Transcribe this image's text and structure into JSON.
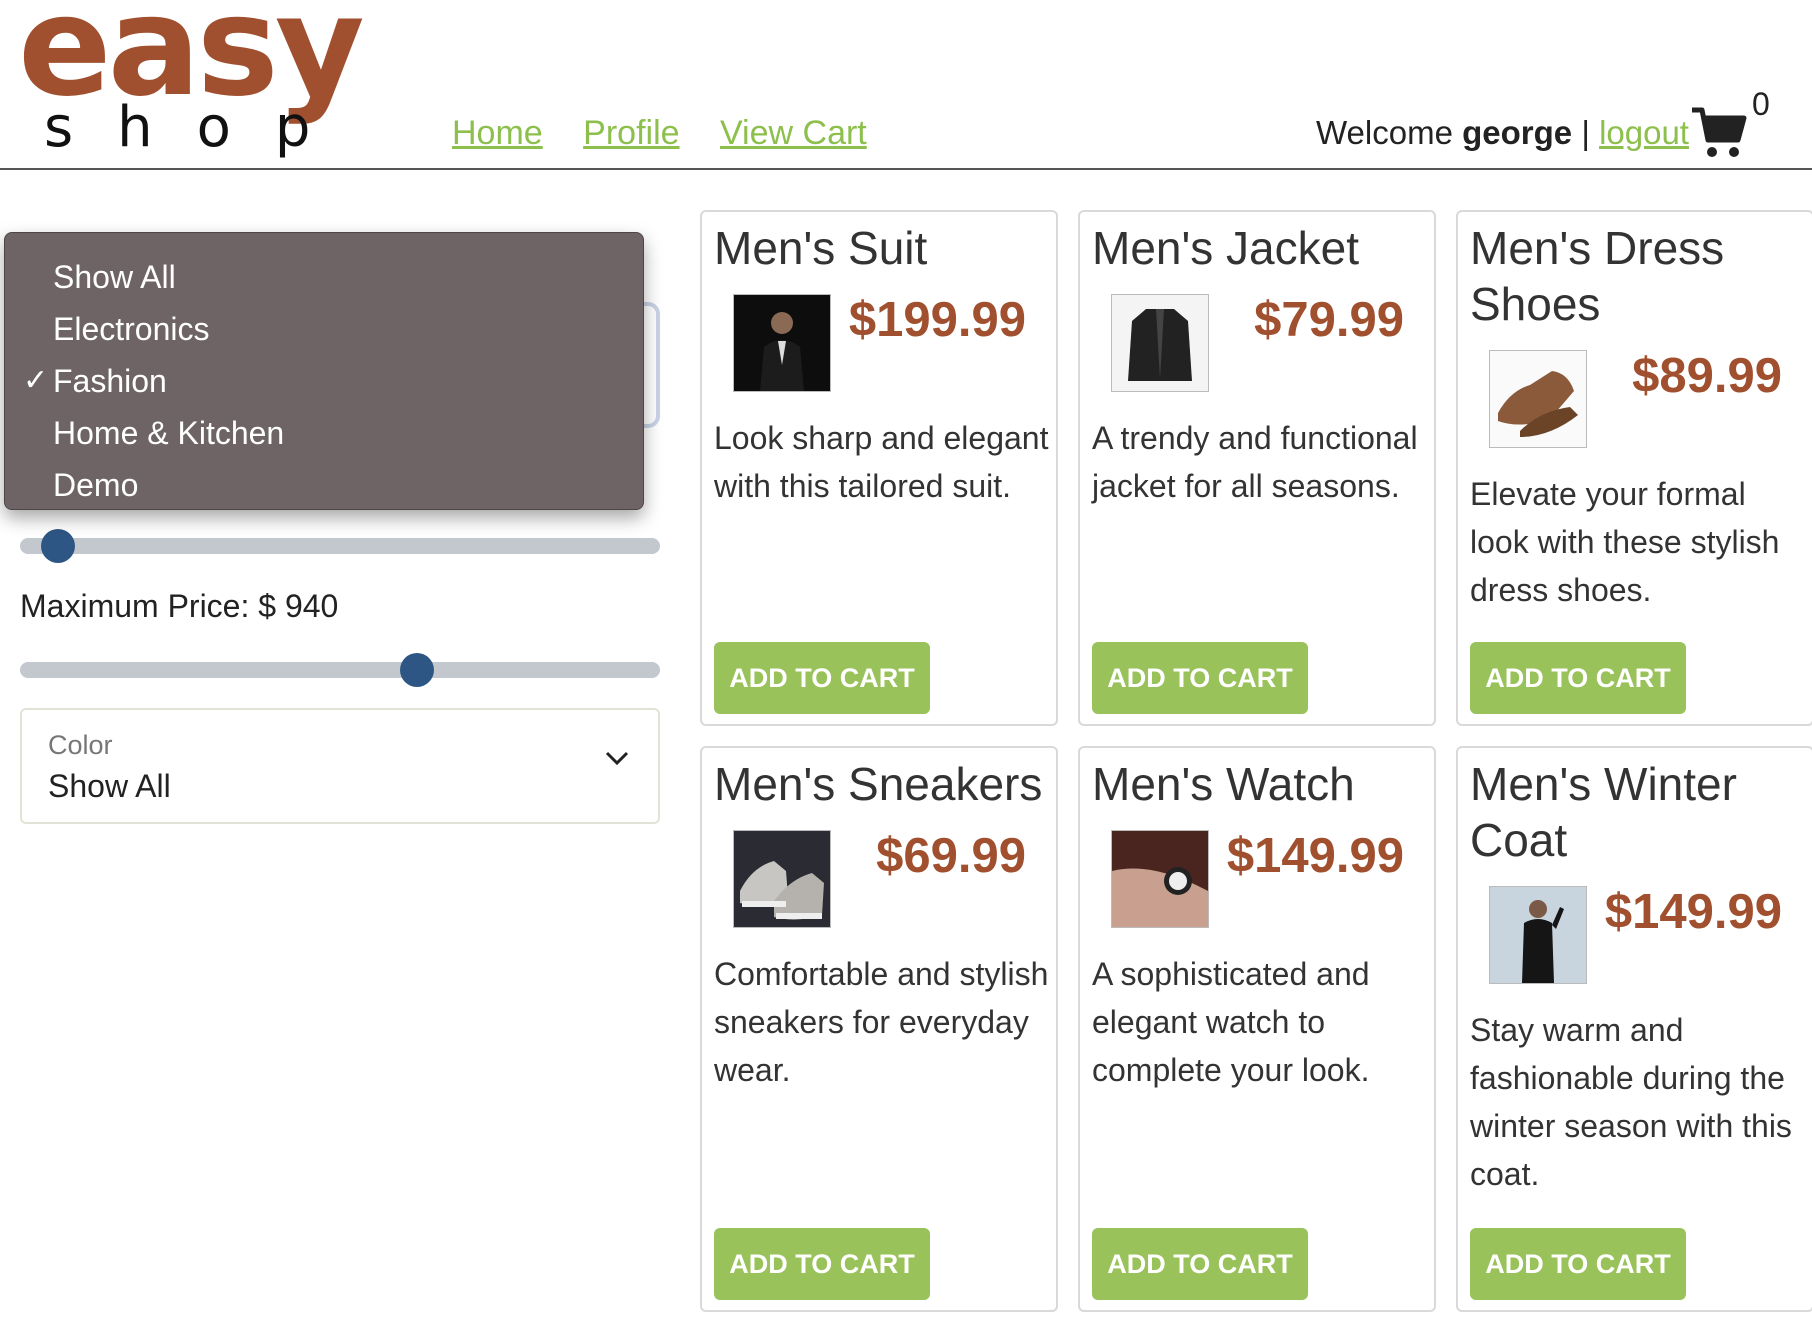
{
  "header": {
    "logo_top": "easy",
    "logo_bottom": "shop",
    "nav": [
      "Home",
      "Profile",
      "View Cart"
    ],
    "welcome_prefix": "Welcome",
    "username": "george",
    "separator": "|",
    "logout": "logout",
    "cart_count": "0"
  },
  "sidebar": {
    "category_dropdown": {
      "options": [
        "Show All",
        "Electronics",
        "Fashion",
        "Home & Kitchen",
        "Demo"
      ],
      "selected": "Fashion",
      "check_glyph": "✓"
    },
    "min_price_fraction": 0.06,
    "max_price_label": "Maximum Price: $ 940",
    "max_price_fraction": 0.62,
    "color": {
      "label": "Color",
      "value": "Show All"
    }
  },
  "products": [
    {
      "name": "Men's Suit",
      "price": "$199.99",
      "description": "Look sharp and elegant with this tailored suit.",
      "button": "ADD TO CART"
    },
    {
      "name": "Men's Jacket",
      "price": "$79.99",
      "description": "A trendy and functional jacket for all seasons.",
      "button": "ADD TO CART"
    },
    {
      "name": "Men's Dress Shoes",
      "price": "$89.99",
      "description": "Elevate your formal look with these stylish dress shoes.",
      "button": "ADD TO CART"
    },
    {
      "name": "Men's Sneakers",
      "price": "$69.99",
      "description": "Comfortable and stylish sneakers for everyday wear.",
      "button": "ADD TO CART"
    },
    {
      "name": "Men's Watch",
      "price": "$149.99",
      "description": "A sophisticated and elegant watch to complete your look.",
      "button": "ADD TO CART"
    },
    {
      "name": "Men's Winter Coat",
      "price": "$149.99",
      "description": "Stay warm and fashionable during the winter season with this coat.",
      "button": "ADD TO CART"
    }
  ],
  "colors": {
    "brand": "#a0502e",
    "link": "#8dbf4c",
    "button": "#99c25a",
    "slider_thumb": "#2e5684"
  }
}
